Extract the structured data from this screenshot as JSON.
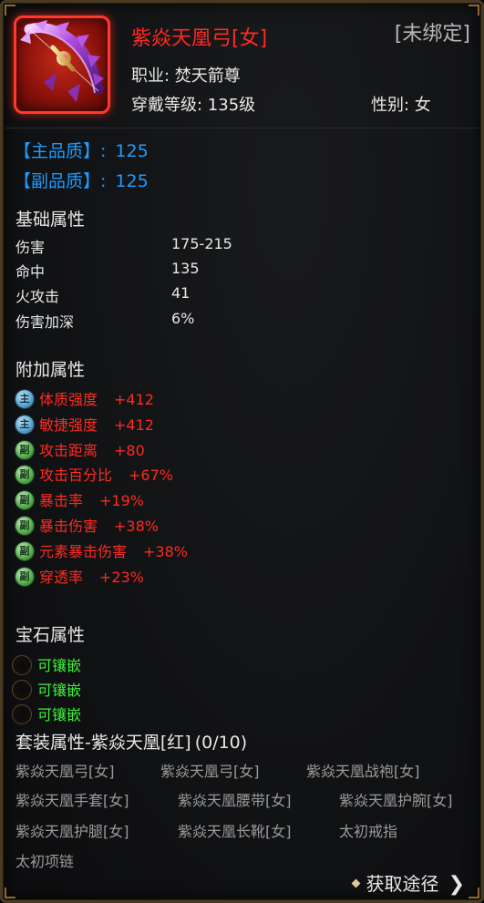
{
  "item": {
    "name": "紫焱天凰弓[女]",
    "bind_status": "[未绑定]",
    "job": "职业: 焚天箭尊",
    "level": "穿戴等级: 135级",
    "gender": "性别: 女",
    "icon": "purple-bow-icon"
  },
  "quality": {
    "main_label": "【主品质】:",
    "main_value": "125",
    "sub_label": "【副品质】:",
    "sub_value": "125"
  },
  "base": {
    "title": "基础属性",
    "rows": [
      {
        "name": "伤害",
        "value": "175-215"
      },
      {
        "name": "命中",
        "value": "135"
      },
      {
        "name": "火攻击",
        "value": "41"
      },
      {
        "name": "伤害加深",
        "value": "6%"
      }
    ]
  },
  "extra": {
    "title": "附加属性",
    "badge_main": "主",
    "badge_sub": "副",
    "rows": [
      {
        "type": "main",
        "name": "体质强度",
        "value": "+412"
      },
      {
        "type": "main",
        "name": "敏捷强度",
        "value": "+412"
      },
      {
        "type": "sub",
        "name": "攻击距离",
        "value": "+80"
      },
      {
        "type": "sub",
        "name": "攻击百分比",
        "value": "+67%"
      },
      {
        "type": "sub",
        "name": "暴击率",
        "value": "+19%"
      },
      {
        "type": "sub",
        "name": "暴击伤害",
        "value": "+38%"
      },
      {
        "type": "sub",
        "name": "元素暴击伤害",
        "value": "+38%"
      },
      {
        "type": "sub",
        "name": "穿透率",
        "value": "+23%"
      }
    ]
  },
  "gems": {
    "title": "宝石属性",
    "slots": [
      "可镶嵌",
      "可镶嵌",
      "可镶嵌"
    ]
  },
  "set": {
    "title": "套装属性-紫焱天凰[红]",
    "count": "(0/10)",
    "items": [
      "紫焱天凰弓[女]",
      "紫焱天凰弓[女]",
      "紫焱天凰战袍[女]",
      "紫焱天凰手套[女]",
      "紫焱天凰腰带[女]",
      "紫焱天凰护腕[女]",
      "紫焱天凰护腿[女]",
      "紫焱天凰长靴[女]",
      "太初戒指",
      "太初项链"
    ]
  },
  "obtain": {
    "label": "获取途径",
    "arrow": "❯"
  },
  "colors": {
    "name_red": "#ff2a22",
    "quality_blue": "#1f9bff",
    "gem_green": "#3df23a",
    "set_gray": "#9a9a9a"
  }
}
